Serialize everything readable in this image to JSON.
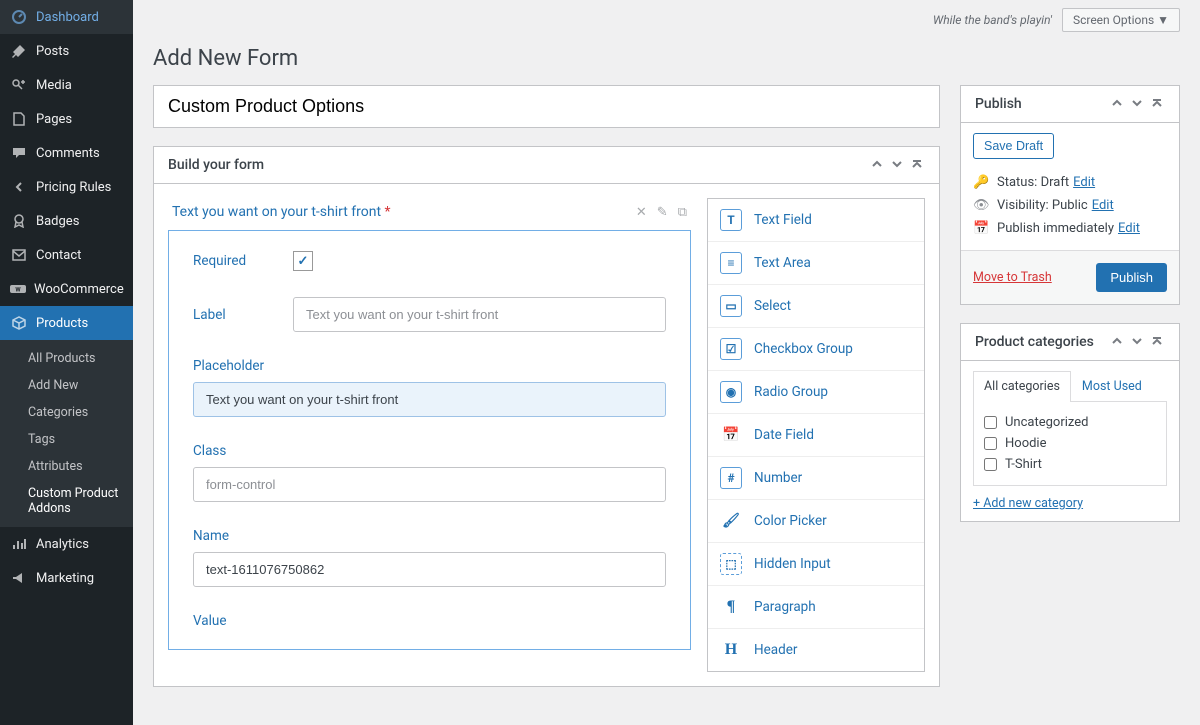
{
  "topbar": {
    "howdy": "While the band's playin'",
    "screen_options": "Screen Options ▼"
  },
  "page_title": "Add New Form",
  "form_title": "Custom Product Options",
  "sidebar": {
    "items": [
      {
        "label": "Dashboard",
        "icon": "dashboard"
      },
      {
        "label": "Posts",
        "icon": "pin"
      },
      {
        "label": "Media",
        "icon": "media"
      },
      {
        "label": "Pages",
        "icon": "page"
      },
      {
        "label": "Comments",
        "icon": "comment"
      },
      {
        "label": "Pricing Rules",
        "icon": "chevron-left"
      },
      {
        "label": "Badges",
        "icon": "badge"
      },
      {
        "label": "Contact",
        "icon": "mail"
      },
      {
        "label": "WooCommerce",
        "icon": "woo"
      },
      {
        "label": "Products",
        "icon": "products",
        "active": true
      },
      {
        "label": "Analytics",
        "icon": "analytics"
      },
      {
        "label": "Marketing",
        "icon": "marketing"
      }
    ],
    "sub": {
      "items": [
        "All Products",
        "Add New",
        "Categories",
        "Tags",
        "Attributes",
        "Custom Product Addons"
      ],
      "active_index": 5
    }
  },
  "builder": {
    "panel_title": "Build your form",
    "field_title": "Text you want on your t-shirt front",
    "required_label": "Required",
    "required_checked": true,
    "label_label": "Label",
    "label_placeholder": "Text you want on your t-shirt front",
    "placeholder_label": "Placeholder",
    "placeholder_value": "Text you want on your t-shirt front",
    "class_label": "Class",
    "class_placeholder": "form-control",
    "name_label": "Name",
    "name_value": "text-1611076750862",
    "value_label": "Value"
  },
  "palette": [
    {
      "label": "Text Field",
      "icon": "T"
    },
    {
      "label": "Text Area",
      "icon": "≡"
    },
    {
      "label": "Select",
      "icon": "▭"
    },
    {
      "label": "Checkbox Group",
      "icon": "☑"
    },
    {
      "label": "Radio Group",
      "icon": "◉"
    },
    {
      "label": "Date Field",
      "icon": "📅"
    },
    {
      "label": "Number",
      "icon": "#"
    },
    {
      "label": "Color Picker",
      "icon": "🖌"
    },
    {
      "label": "Hidden Input",
      "icon": "⬚"
    },
    {
      "label": "Paragraph",
      "icon": "¶"
    },
    {
      "label": "Header",
      "icon": "H"
    }
  ],
  "publish": {
    "box_title": "Publish",
    "save_draft": "Save Draft",
    "status_label": "Status:",
    "status_value": "Draft",
    "visibility_label": "Visibility:",
    "visibility_value": "Public",
    "schedule_label": "Publish",
    "schedule_value": "immediately",
    "edit": "Edit",
    "trash": "Move to Trash",
    "publish_btn": "Publish"
  },
  "categories": {
    "box_title": "Product categories",
    "tabs": [
      "All categories",
      "Most Used"
    ],
    "items": [
      "Uncategorized",
      "Hoodie",
      "T-Shirt"
    ],
    "add_new": "+ Add new category"
  }
}
